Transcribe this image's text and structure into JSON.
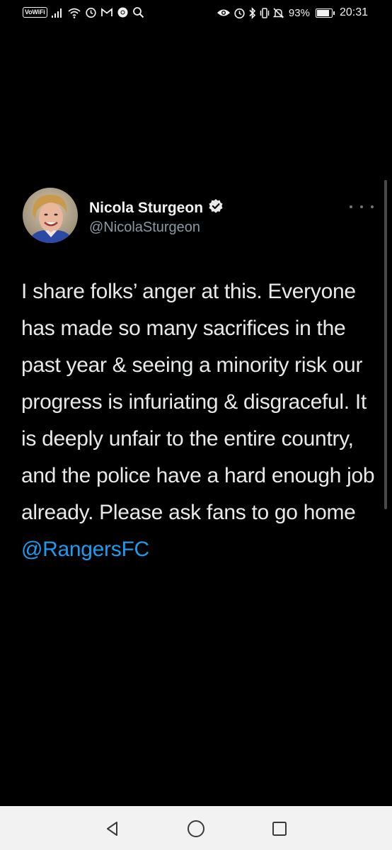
{
  "status_bar": {
    "vowifi_label": "VoWiFi",
    "battery_percent": "93%",
    "battery_level": 0.93,
    "time": "20:31",
    "left_icons": [
      "signal-icon",
      "wifi-icon",
      "alarm-icon",
      "gmail-icon",
      "chrome-icon",
      "search-icon"
    ],
    "right_icons": [
      "eye-icon",
      "alarm-icon",
      "bluetooth-icon",
      "vibrate-icon",
      "mute-icon",
      "battery-icon"
    ]
  },
  "tweet": {
    "display_name": "Nicola Sturgeon",
    "verified": true,
    "handle": "@NicolaSturgeon",
    "body": "I share folks’ anger at this. Everyone has made so many sacrifices in the past year & seeing a minority risk our progress is infuriating & disgraceful. It is deeply unfair to the entire country, and the police have a hard enough job already. Please ask fans to go home ",
    "mention": "@RangersFC"
  },
  "colors": {
    "background": "#000000",
    "text": "#e7e9ea",
    "secondary_text": "#8b98a5",
    "link": "#1d9bf0",
    "nav_bar": "#f2f2f2"
  },
  "nav_bar": {
    "buttons": [
      "back-icon",
      "home-icon",
      "recents-icon"
    ]
  }
}
